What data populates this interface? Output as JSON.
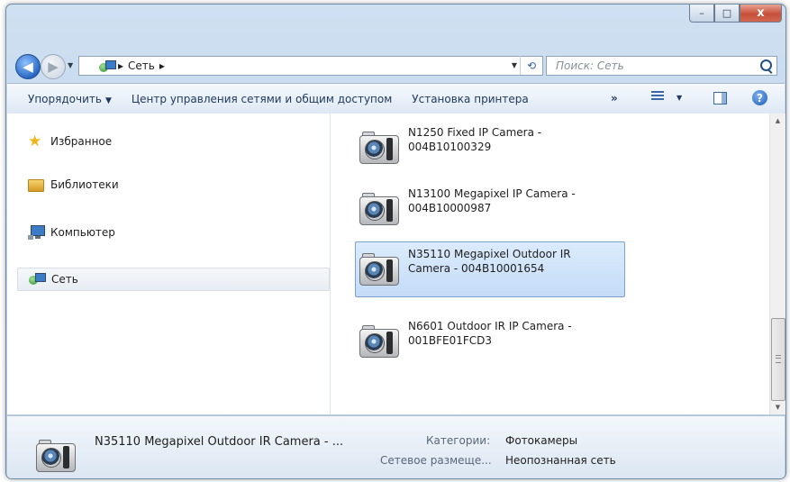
{
  "window": {
    "caption": {
      "minimize": "–",
      "maximize": "□",
      "close": "x"
    }
  },
  "address": {
    "back": "◀",
    "forward": "▶",
    "crumb_sep": "▸",
    "crumb": "Сеть",
    "crumb_end": "▸",
    "search_placeholder": "Поиск: Сеть"
  },
  "toolbar": {
    "organize": "Упорядочить",
    "network_center": "Центр управления сетями и общим доступом",
    "add_printer": "Установка принтера",
    "more": "»"
  },
  "nav": {
    "items": [
      {
        "label": "Избранное",
        "icon": "star-icon"
      },
      {
        "label": "Библиотеки",
        "icon": "libraries-icon"
      },
      {
        "label": "Компьютер",
        "icon": "computer-icon"
      },
      {
        "label": "Сеть",
        "icon": "network-icon",
        "selected": true
      }
    ]
  },
  "files": [
    {
      "line1": "N1250 Fixed IP Camera -",
      "line2": "004B10100329",
      "icon": "camera-icon"
    },
    {
      "line1": "N13100 Megapixel IP Camera -",
      "line2": "004B10000987",
      "icon": "camera-icon"
    },
    {
      "line1": "N35110 Megapixel Outdoor IR",
      "line2": "Camera - 004B10001654",
      "icon": "camera-icon",
      "selected": true
    },
    {
      "line1": "N6601 Outdoor IR IP Camera -",
      "line2": "001BFE01FCD3",
      "icon": "camera-icon"
    }
  ],
  "details": {
    "name": "N35110 Megapixel Outdoor IR Camera - ...",
    "category_label": "Категории:",
    "category_value": "Фотокамеры",
    "location_label": "Сетевое размеще...",
    "location_value": "Неопознанная сеть"
  }
}
